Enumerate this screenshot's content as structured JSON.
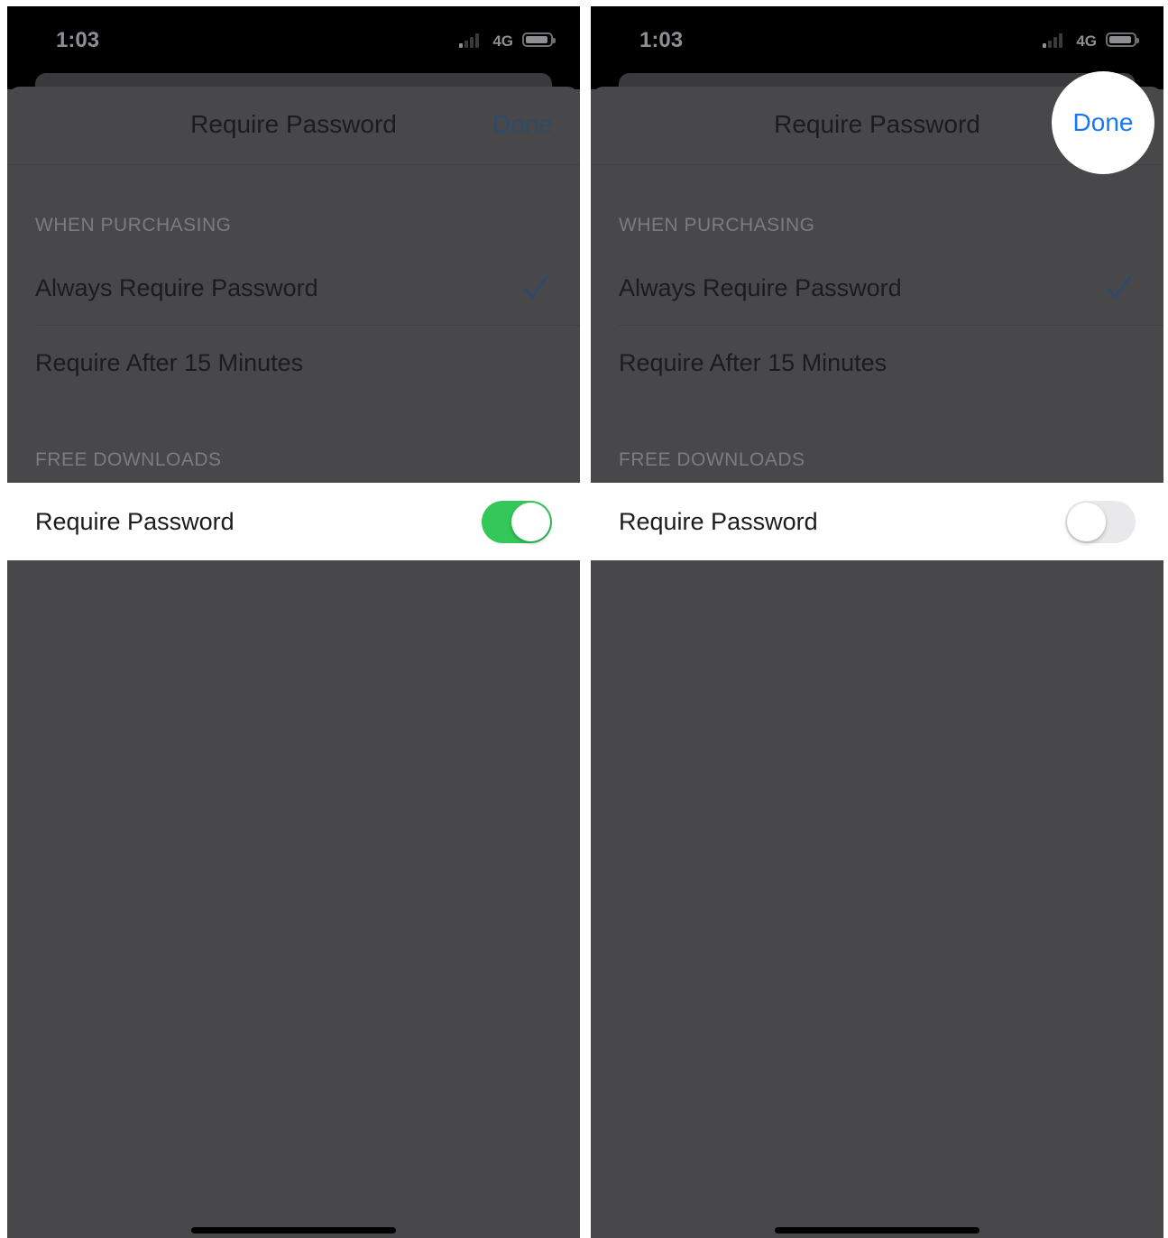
{
  "panels": [
    {
      "status": {
        "time": "1:03",
        "network": "4G"
      },
      "nav": {
        "title": "Require Password",
        "done_label": "Done"
      },
      "purchasing": {
        "header": "WHEN PURCHASING",
        "options": [
          "Always Require Password",
          "Require After 15 Minutes"
        ],
        "selected": "Always Require Password"
      },
      "free_downloads": {
        "header": "FREE DOWNLOADS",
        "toggle_label": "Require Password",
        "toggle_on": true
      }
    },
    {
      "status": {
        "time": "1:03",
        "network": "4G"
      },
      "nav": {
        "title": "Require Password",
        "done_label": "Done"
      },
      "purchasing": {
        "header": "WHEN PURCHASING",
        "options": [
          "Always Require Password",
          "Require After 15 Minutes"
        ],
        "selected": "Always Require Password"
      },
      "free_downloads": {
        "header": "FREE DOWNLOADS",
        "toggle_label": "Require Password",
        "toggle_on": false
      }
    }
  ],
  "colors": {
    "toggle_on": "#34c759",
    "toggle_off": "#e9e9eb",
    "done_highlight": "#1877f2",
    "checkmark": "#2e4a6b"
  },
  "icons": {
    "status": [
      "cellular-signal-icon",
      "battery-icon"
    ],
    "selection": "checkmark-icon"
  }
}
